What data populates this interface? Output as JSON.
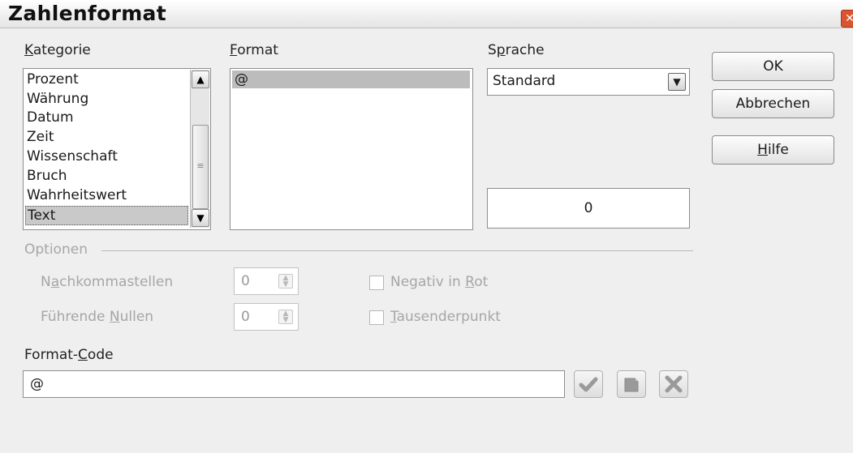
{
  "window": {
    "title": "Zahlenformat",
    "close_glyph": "✕"
  },
  "kategorie": {
    "label_pre": "",
    "label_mnemonic": "K",
    "label_post": "ategorie",
    "items": [
      "Prozent",
      "Währung",
      "Datum",
      "Zeit",
      "Wissenschaft",
      "Bruch",
      "Wahrheitswert",
      "Text"
    ],
    "selected_index": 7
  },
  "format": {
    "label_mnemonic": "F",
    "label_post": "ormat",
    "items": [
      "@"
    ]
  },
  "sprache": {
    "label_pre": "S",
    "label_mnemonic": "p",
    "label_post": "rache",
    "value": "Standard"
  },
  "preview": {
    "value": "0"
  },
  "buttons": {
    "ok": "OK",
    "cancel": "Abbrechen",
    "help_mnemonic": "H",
    "help_post": "ilfe"
  },
  "optionen": {
    "label": "Optionen",
    "decimals_pre": "N",
    "decimals_mnemonic": "a",
    "decimals_post": "chkommastellen",
    "decimals_value": "0",
    "leading_pre": "Führende ",
    "leading_mnemonic": "N",
    "leading_post": "ullen",
    "leading_value": "0",
    "negative_pre": "Negativ in ",
    "negative_mnemonic": "R",
    "negative_post": "ot",
    "thousands_mnemonic": "T",
    "thousands_post": "ausenderpunkt"
  },
  "format_code": {
    "label_pre": "Format-",
    "label_mnemonic": "C",
    "label_post": "ode",
    "value": "@"
  },
  "icons": {
    "accept": "checkmark-icon",
    "edit_comment": "comment-icon",
    "delete": "delete-x-icon"
  },
  "colors": {
    "selected_bg": "#c9c9c9",
    "disabled_text": "#a6a6a6",
    "dialog_bg": "#efefef"
  }
}
